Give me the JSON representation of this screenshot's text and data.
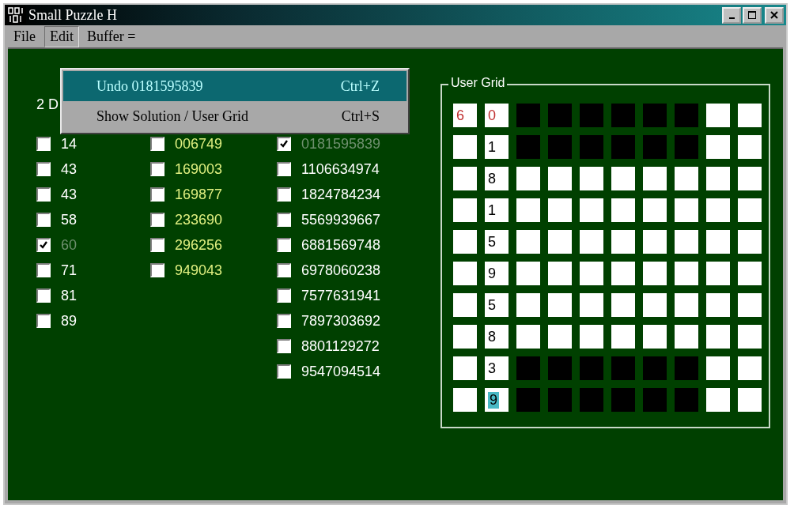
{
  "window": {
    "title": "Small Puzzle H"
  },
  "menu": [
    {
      "label": "File",
      "selected": false
    },
    {
      "label": "Edit",
      "selected": true
    }
  ],
  "buffer_label": "Buffer =",
  "edit_menu": [
    {
      "label": "Undo 0181595839",
      "shortcut": "Ctrl+Z",
      "selected": true
    },
    {
      "label": "Show Solution / User Grid",
      "shortcut": "Ctrl+S",
      "selected": false
    }
  ],
  "list_heading": "2 D",
  "columns": [
    {
      "color": "#ffffff",
      "items": [
        {
          "text": "14",
          "checked": false
        },
        {
          "text": "43",
          "checked": false
        },
        {
          "text": "43",
          "checked": false
        },
        {
          "text": "58",
          "checked": false
        },
        {
          "text": "60",
          "checked": true
        },
        {
          "text": "71",
          "checked": false
        },
        {
          "text": "81",
          "checked": false
        },
        {
          "text": "89",
          "checked": false
        }
      ]
    },
    {
      "color": "#e0f080",
      "items": [
        {
          "text": "006749",
          "checked": false
        },
        {
          "text": "169003",
          "checked": false
        },
        {
          "text": "169877",
          "checked": false
        },
        {
          "text": "233690",
          "checked": false
        },
        {
          "text": "296256",
          "checked": false
        },
        {
          "text": "949043",
          "checked": false
        }
      ]
    },
    {
      "color": "#ffffff",
      "items": [
        {
          "text": "0181595839",
          "checked": true
        },
        {
          "text": "1106634974",
          "checked": false
        },
        {
          "text": "1824784234",
          "checked": false
        },
        {
          "text": "5569939667",
          "checked": false
        },
        {
          "text": "6881569748",
          "checked": false
        },
        {
          "text": "6978060238",
          "checked": false
        },
        {
          "text": "7577631941",
          "checked": false
        },
        {
          "text": "7897303692",
          "checked": false
        },
        {
          "text": "8801129272",
          "checked": false
        },
        {
          "text": "9547094514",
          "checked": false
        }
      ]
    }
  ],
  "user_grid": {
    "title": "User Grid",
    "rows": [
      {
        "label": {
          "text": "6",
          "color": "#c03030"
        },
        "digit": {
          "text": "0",
          "color": "#c03030",
          "selected": false
        },
        "cells": [
          {
            "filled": true
          },
          {
            "filled": true
          },
          {
            "filled": true
          },
          {
            "filled": true
          },
          {
            "filled": true
          },
          {
            "filled": true
          },
          {
            "filled": false
          },
          {
            "filled": false
          }
        ]
      },
      {
        "digit": {
          "text": "1",
          "selected": false
        },
        "cells": [
          {
            "filled": true
          },
          {
            "filled": true
          },
          {
            "filled": true
          },
          {
            "filled": true
          },
          {
            "filled": true
          },
          {
            "filled": true
          },
          {
            "filled": false
          },
          {
            "filled": false
          }
        ]
      },
      {
        "digit": {
          "text": "8",
          "selected": false
        },
        "cells": [
          {
            "filled": false
          },
          {
            "filled": false
          },
          {
            "filled": false
          },
          {
            "filled": false
          },
          {
            "filled": false
          },
          {
            "filled": false
          },
          {
            "filled": false
          },
          {
            "filled": false
          }
        ]
      },
      {
        "digit": {
          "text": "1",
          "selected": false
        },
        "cells": [
          {
            "filled": false
          },
          {
            "filled": false
          },
          {
            "filled": false
          },
          {
            "filled": false
          },
          {
            "filled": false
          },
          {
            "filled": false
          },
          {
            "filled": false
          },
          {
            "filled": false
          }
        ]
      },
      {
        "digit": {
          "text": "5",
          "selected": false
        },
        "cells": [
          {
            "filled": false
          },
          {
            "filled": false
          },
          {
            "filled": false
          },
          {
            "filled": false
          },
          {
            "filled": false
          },
          {
            "filled": false
          },
          {
            "filled": false
          },
          {
            "filled": false
          }
        ]
      },
      {
        "digit": {
          "text": "9",
          "selected": false
        },
        "cells": [
          {
            "filled": false
          },
          {
            "filled": false
          },
          {
            "filled": false
          },
          {
            "filled": false
          },
          {
            "filled": false
          },
          {
            "filled": false
          },
          {
            "filled": false
          },
          {
            "filled": false
          }
        ]
      },
      {
        "digit": {
          "text": "5",
          "selected": false
        },
        "cells": [
          {
            "filled": false
          },
          {
            "filled": false
          },
          {
            "filled": false
          },
          {
            "filled": false
          },
          {
            "filled": false
          },
          {
            "filled": false
          },
          {
            "filled": false
          },
          {
            "filled": false
          }
        ]
      },
      {
        "digit": {
          "text": "8",
          "selected": false
        },
        "cells": [
          {
            "filled": false
          },
          {
            "filled": false
          },
          {
            "filled": false
          },
          {
            "filled": false
          },
          {
            "filled": false
          },
          {
            "filled": false
          },
          {
            "filled": false
          },
          {
            "filled": false
          }
        ]
      },
      {
        "digit": {
          "text": "3",
          "selected": false
        },
        "cells": [
          {
            "filled": true
          },
          {
            "filled": true
          },
          {
            "filled": true
          },
          {
            "filled": true
          },
          {
            "filled": true
          },
          {
            "filled": true
          },
          {
            "filled": false
          },
          {
            "filled": false
          }
        ]
      },
      {
        "digit": {
          "text": "9",
          "selected": true
        },
        "cells": [
          {
            "filled": true
          },
          {
            "filled": true
          },
          {
            "filled": true
          },
          {
            "filled": true
          },
          {
            "filled": true
          },
          {
            "filled": true
          },
          {
            "filled": false
          },
          {
            "filled": false
          }
        ]
      }
    ]
  }
}
